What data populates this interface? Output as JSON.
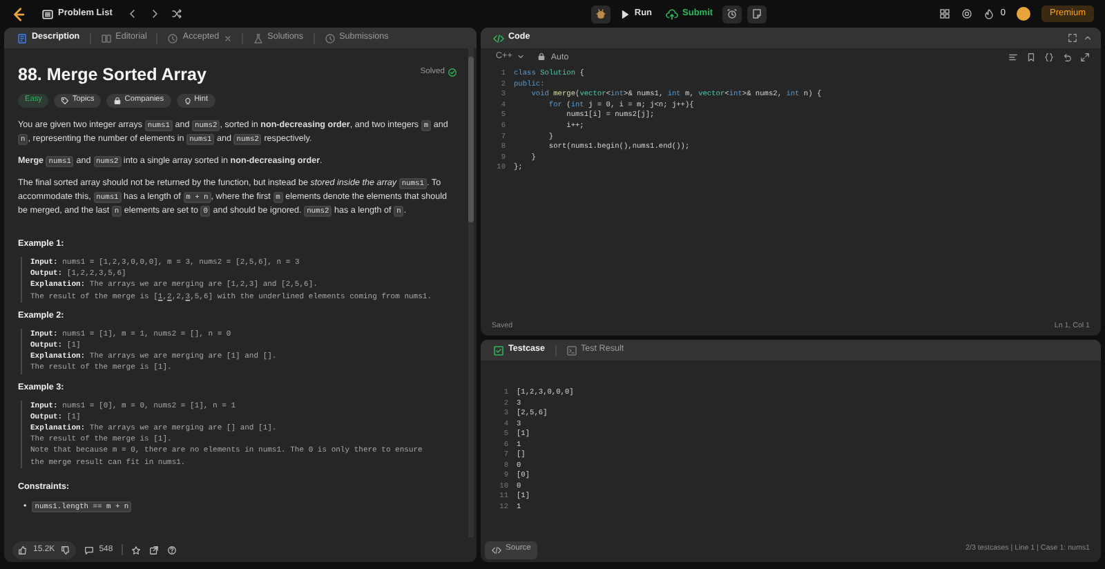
{
  "top_bar": {
    "problem_list": "Problem List",
    "run": "Run",
    "submit": "Submit",
    "streak": "0",
    "premium": "Premium"
  },
  "description_panel": {
    "tabs": [
      {
        "label": "Description",
        "selected": true,
        "kind": "description"
      },
      {
        "label": "Editorial",
        "selected": false,
        "kind": "editorial"
      },
      {
        "label": "Accepted",
        "selected": false,
        "kind": "accepted"
      },
      {
        "label": "Solutions",
        "selected": false,
        "kind": "solutions"
      },
      {
        "label": "Submissions",
        "selected": false,
        "kind": "submissions"
      }
    ],
    "title": "88. Merge Sorted Array",
    "status": "Solved",
    "tags": [
      {
        "label": "Easy",
        "kind": "difficulty"
      },
      {
        "label": "Topics",
        "kind": "topics"
      },
      {
        "label": "Companies",
        "kind": "companies"
      },
      {
        "label": "Hint",
        "kind": "hint"
      }
    ],
    "paragraphs": [
      [
        {
          "kind": "text",
          "text": "You are given two integer arrays "
        },
        {
          "kind": "code",
          "text": "nums1"
        },
        {
          "kind": "text",
          "text": " and "
        },
        {
          "kind": "code",
          "text": "nums2"
        },
        {
          "kind": "text",
          "text": ", sorted in "
        },
        {
          "kind": "bold",
          "text": "non-decreasing order"
        },
        {
          "kind": "text",
          "text": ", and two integers "
        },
        {
          "kind": "code",
          "text": "m"
        },
        {
          "kind": "text",
          "text": " and "
        },
        {
          "kind": "code",
          "text": "n"
        },
        {
          "kind": "text",
          "text": ", representing the number of elements in "
        },
        {
          "kind": "code",
          "text": "nums1"
        },
        {
          "kind": "text",
          "text": " and "
        },
        {
          "kind": "code",
          "text": "nums2"
        },
        {
          "kind": "text",
          "text": " respectively."
        }
      ],
      [
        {
          "kind": "bold",
          "text": "Merge "
        },
        {
          "kind": "code",
          "text": "nums1"
        },
        {
          "kind": "text",
          "text": " and "
        },
        {
          "kind": "code",
          "text": "nums2"
        },
        {
          "kind": "text",
          "text": " into a single array sorted in "
        },
        {
          "kind": "bold",
          "text": "non-decreasing order"
        },
        {
          "kind": "text",
          "text": "."
        }
      ],
      [
        {
          "kind": "text",
          "text": "The final sorted array should not be returned by the function, but instead be "
        },
        {
          "kind": "italic",
          "text": "stored inside the array "
        },
        {
          "kind": "code",
          "text": "nums1"
        },
        {
          "kind": "text",
          "text": ". To accommodate this, "
        },
        {
          "kind": "code",
          "text": "nums1"
        },
        {
          "kind": "text",
          "text": " has a length of "
        },
        {
          "kind": "code",
          "text": "m + n"
        },
        {
          "kind": "text",
          "text": ", where the first "
        },
        {
          "kind": "code",
          "text": "m"
        },
        {
          "kind": "text",
          "text": " elements denote the elements that should be merged, and the last "
        },
        {
          "kind": "code",
          "text": "n"
        },
        {
          "kind": "text",
          "text": " elements are set to "
        },
        {
          "kind": "code",
          "text": "0"
        },
        {
          "kind": "text",
          "text": " and should be ignored. "
        },
        {
          "kind": "code",
          "text": "nums2"
        },
        {
          "kind": "text",
          "text": " has a length of "
        },
        {
          "kind": "code",
          "text": "n"
        },
        {
          "kind": "text",
          "text": "."
        }
      ]
    ],
    "examples": [
      {
        "heading": "Example 1:",
        "lines": [
          [
            {
              "kind": "bold",
              "text": "Input:"
            },
            {
              "kind": "text",
              "text": " nums1 = [1,2,3,0,0,0], m = 3, nums2 = [2,5,6], n = 3"
            }
          ],
          [
            {
              "kind": "bold",
              "text": "Output:"
            },
            {
              "kind": "text",
              "text": " [1,2,2,3,5,6]"
            }
          ],
          [
            {
              "kind": "bold",
              "text": "Explanation:"
            },
            {
              "kind": "text",
              "text": " The arrays we are merging are [1,2,3] and [2,5,6]."
            }
          ],
          [
            {
              "kind": "text",
              "text": "The result of the merge is ["
            },
            {
              "kind": "underline",
              "text": "1"
            },
            {
              "kind": "text",
              "text": ","
            },
            {
              "kind": "underline",
              "text": "2"
            },
            {
              "kind": "text",
              "text": ",2,"
            },
            {
              "kind": "underline",
              "text": "3"
            },
            {
              "kind": "text",
              "text": ",5,6] with the underlined elements coming from nums1."
            }
          ]
        ]
      },
      {
        "heading": "Example 2:",
        "lines": [
          [
            {
              "kind": "bold",
              "text": "Input:"
            },
            {
              "kind": "text",
              "text": " nums1 = [1], m = 1, nums2 = [], n = 0"
            }
          ],
          [
            {
              "kind": "bold",
              "text": "Output:"
            },
            {
              "kind": "text",
              "text": " [1]"
            }
          ],
          [
            {
              "kind": "bold",
              "text": "Explanation:"
            },
            {
              "kind": "text",
              "text": " The arrays we are merging are [1] and []."
            }
          ],
          [
            {
              "kind": "text",
              "text": "The result of the merge is [1]."
            }
          ]
        ]
      },
      {
        "heading": "Example 3:",
        "lines": [
          [
            {
              "kind": "bold",
              "text": "Input:"
            },
            {
              "kind": "text",
              "text": " nums1 = [0], m = 0, nums2 = [1], n = 1"
            }
          ],
          [
            {
              "kind": "bold",
              "text": "Output:"
            },
            {
              "kind": "text",
              "text": " [1]"
            }
          ],
          [
            {
              "kind": "bold",
              "text": "Explanation:"
            },
            {
              "kind": "text",
              "text": " The arrays we are merging are [] and [1]."
            }
          ],
          [
            {
              "kind": "text",
              "text": "The result of the merge is [1]."
            }
          ],
          [
            {
              "kind": "text",
              "text": "Note that because m = 0, there are no elements in nums1. The 0 is only there to ensure"
            }
          ],
          [
            {
              "kind": "text",
              "text": "the merge result can fit in nums1."
            }
          ]
        ]
      }
    ],
    "constraints_heading": "Constraints:",
    "constraints": [
      {
        "bullet": "•",
        "segments": [
          {
            "kind": "code",
            "text": "nums1.length == m + n"
          }
        ]
      }
    ],
    "footer": {
      "likes": "15.2K",
      "comments": "548"
    }
  },
  "code_panel": {
    "title": "Code",
    "language": "C++",
    "mode": "Auto",
    "lines": [
      {
        "number": "1",
        "tokens": [
          {
            "kind": "keyword",
            "text": "class"
          },
          {
            "kind": "type",
            "text": " Solution"
          },
          {
            "kind": "plain",
            "text": " {"
          }
        ]
      },
      {
        "number": "2",
        "tokens": [
          {
            "kind": "keyword",
            "text": "public:"
          }
        ]
      },
      {
        "number": "3",
        "tokens": [
          {
            "kind": "keyword",
            "text": "    void"
          },
          {
            "kind": "function",
            "text": " merge"
          },
          {
            "kind": "plain",
            "text": "("
          },
          {
            "kind": "type",
            "text": "vector"
          },
          {
            "kind": "plain",
            "text": "<"
          },
          {
            "kind": "keyword",
            "text": "int"
          },
          {
            "kind": "plain",
            "text": ">& nums1, "
          },
          {
            "kind": "keyword",
            "text": "int"
          },
          {
            "kind": "plain",
            "text": " m, "
          },
          {
            "kind": "type",
            "text": "vector"
          },
          {
            "kind": "plain",
            "text": "<"
          },
          {
            "kind": "keyword",
            "text": "int"
          },
          {
            "kind": "plain",
            "text": ">& nums2, "
          },
          {
            "kind": "keyword",
            "text": "int"
          },
          {
            "kind": "plain",
            "text": " n) {"
          }
        ]
      },
      {
        "number": "4",
        "tokens": [
          {
            "kind": "keyword",
            "text": "        for"
          },
          {
            "kind": "plain",
            "text": " ("
          },
          {
            "kind": "keyword",
            "text": "int"
          },
          {
            "kind": "plain",
            "text": " j = 0, i = m; j<n; j++){"
          }
        ]
      },
      {
        "number": "5",
        "tokens": [
          {
            "kind": "plain",
            "text": "            nums1[i] = nums2[j];"
          }
        ]
      },
      {
        "number": "6",
        "tokens": [
          {
            "kind": "plain",
            "text": "            i++;"
          }
        ]
      },
      {
        "number": "7",
        "tokens": [
          {
            "kind": "plain",
            "text": "        }"
          }
        ]
      },
      {
        "number": "8",
        "tokens": [
          {
            "kind": "plain",
            "text": "        sort(nums1.begin(),nums1.end());"
          }
        ]
      },
      {
        "number": "9",
        "tokens": [
          {
            "kind": "plain",
            "text": "    }"
          }
        ]
      },
      {
        "number": "10",
        "tokens": [
          {
            "kind": "plain",
            "text": "};"
          }
        ]
      }
    ],
    "status": "Saved",
    "cursor": "Ln 1, Col 1"
  },
  "testcase_panel": {
    "tabs": [
      {
        "label": "Testcase",
        "selected": true,
        "kind": "testcase"
      },
      {
        "label": "Test Result",
        "selected": false,
        "kind": "result"
      }
    ],
    "lines": [
      {
        "number": "1",
        "text": "[1,2,3,0,0,0]"
      },
      {
        "number": "2",
        "text": "3"
      },
      {
        "number": "3",
        "text": "[2,5,6]"
      },
      {
        "number": "4",
        "text": "3"
      },
      {
        "number": "5",
        "text": "[1]"
      },
      {
        "number": "6",
        "text": "1"
      },
      {
        "number": "7",
        "text": "[]"
      },
      {
        "number": "8",
        "text": "0"
      },
      {
        "number": "9",
        "text": "[0]"
      },
      {
        "number": "10",
        "text": "0"
      },
      {
        "number": "11",
        "text": "[1]"
      },
      {
        "number": "12",
        "text": "1"
      }
    ],
    "source": "Source",
    "status": "2/3 testcases | Line 1 | Case 1: nums1"
  }
}
